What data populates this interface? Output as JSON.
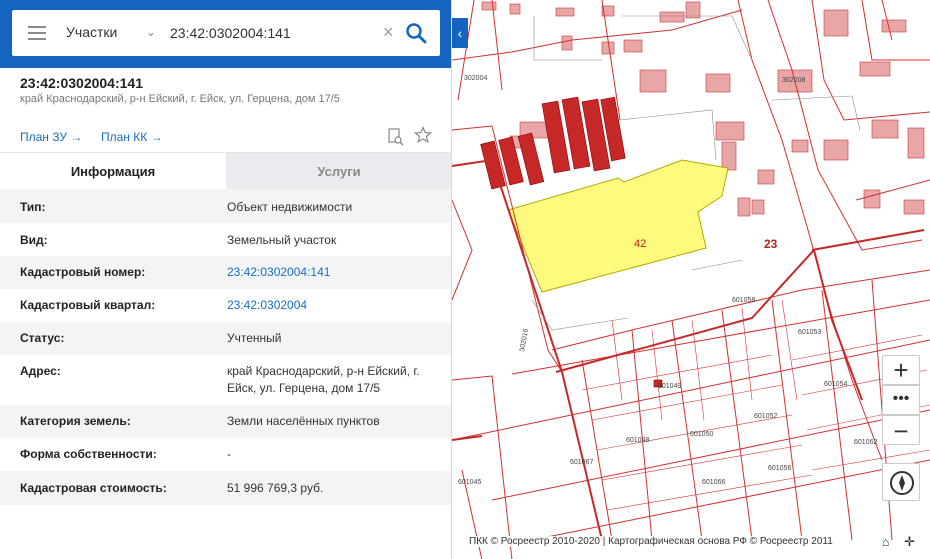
{
  "search": {
    "type_label": "Участки",
    "query": "23:42:0302004:141"
  },
  "object": {
    "number": "23:42:0302004:141",
    "address": "край Краснодарский, р-н Ейский, г. Ейск, ул. Герцена, дом 17/5"
  },
  "links": {
    "plan_zu": "План ЗУ →",
    "plan_kk": "План КК →"
  },
  "tabs": {
    "info": "Информация",
    "services": "Услуги"
  },
  "details": [
    {
      "label": "Тип:",
      "value": "Объект недвижимости"
    },
    {
      "label": "Вид:",
      "value": "Земельный участок"
    },
    {
      "label": "Кадастровый номер:",
      "value": "23:42:0302004:141"
    },
    {
      "label": "Кадастровый квартал:",
      "value": "23:42:0302004"
    },
    {
      "label": "Статус:",
      "value": "Учтенный"
    },
    {
      "label": "Адрес:",
      "value": "край Краснодарский, р-н Ейский, г. Ейск, ул. Герцена, дом 17/5"
    },
    {
      "label": "Категория земель:",
      "value": "Земли населённых пунктов"
    },
    {
      "label": "Форма собственности:",
      "value": "-"
    },
    {
      "label": "Кадастровая стоимость:",
      "value": "51 996 769,3 руб."
    }
  ],
  "map": {
    "label_42": "42",
    "label_23": "23",
    "label_302004": "302004",
    "label_302016": "302016",
    "label_302008": "302008",
    "parcel_labels": [
      "601049",
      "601048",
      "601050",
      "601054",
      "601053",
      "601052",
      "601062",
      "601058",
      "601066",
      "601067",
      "601056",
      "601045"
    ],
    "copyright": "ПКК © Росреестр 2010-2020 | Картографическая основа РФ © Росреестр 2011",
    "zoom_in": "+",
    "zoom_more": "•••",
    "zoom_out": "−"
  },
  "colors": {
    "header_blue": "#1565c0",
    "link_blue": "#1a6bc4",
    "parcel_yellow": "#fdfa7d",
    "building_red": "#c62828",
    "building_pink": "#e8a0a0",
    "boundary_red": "#d32f2f"
  }
}
